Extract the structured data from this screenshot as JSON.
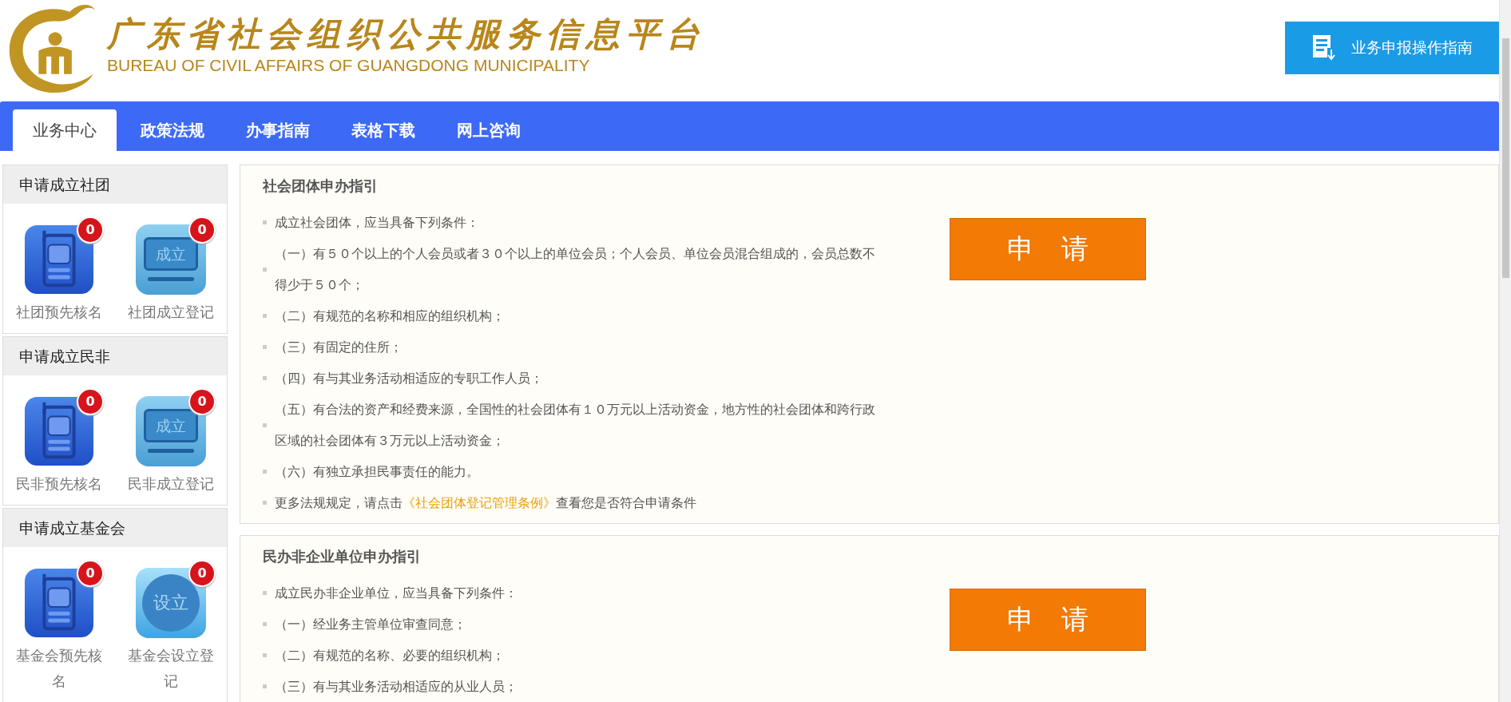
{
  "header": {
    "title": "广东省社会组织公共服务信息平台",
    "subtitle": "BUREAU OF CIVIL AFFAIRS OF GUANGDONG MUNICIPALITY",
    "guide_button": "业务申报操作指南"
  },
  "nav": [
    {
      "label": "业务中心",
      "selected": true
    },
    {
      "label": "政策法规",
      "selected": false
    },
    {
      "label": "办事指南",
      "selected": false
    },
    {
      "label": "表格下载",
      "selected": false
    },
    {
      "label": "网上咨询",
      "selected": false
    }
  ],
  "sidebar": [
    {
      "title": "申请成立社团",
      "items": [
        {
          "kind": "phone",
          "label": "社团预先核名",
          "badge": "0"
        },
        {
          "kind": "monitor",
          "icon_text": "成立",
          "label": "社团成立登记",
          "badge": "0"
        }
      ]
    },
    {
      "title": "申请成立民非",
      "items": [
        {
          "kind": "phone",
          "label": "民非预先核名",
          "badge": "0"
        },
        {
          "kind": "monitor",
          "icon_text": "成立",
          "label": "民非成立登记",
          "badge": "0"
        }
      ]
    },
    {
      "title": "申请成立基金会",
      "items": [
        {
          "kind": "phone",
          "label": "基金会预先核名",
          "badge": "0"
        },
        {
          "kind": "circle",
          "icon_text": "设立",
          "label": "基金会设立登记",
          "badge": "0"
        }
      ]
    }
  ],
  "sections": [
    {
      "title": "社会团体申办指引",
      "button": "申　请",
      "items": [
        {
          "kind": "text",
          "text": "成立社会团体，应当具备下列条件："
        },
        {
          "kind": "text",
          "text": "（一）有５０个以上的个人会员或者３０个以上的单位会员；个人会员、单位会员混合组成的，会员总数不得少于５０个；"
        },
        {
          "kind": "text",
          "text": "（二）有规范的名称和相应的组织机构；"
        },
        {
          "kind": "text",
          "text": "（三）有固定的住所；"
        },
        {
          "kind": "text",
          "text": "（四）有与其业务活动相适应的专职工作人员；"
        },
        {
          "kind": "text",
          "text": "（五）有合法的资产和经费来源，全国性的社会团体有１０万元以上活动资金，地方性的社会团体和跨行政区域的社会团体有３万元以上活动资金；"
        },
        {
          "kind": "text",
          "text": "（六）有独立承担民事责任的能力。"
        },
        {
          "kind": "link",
          "before": "更多法规规定，请点击",
          "link": "《社会团体登记管理条例》",
          "after": "查看您是否符合申请条件"
        }
      ]
    },
    {
      "title": "民办非企业单位申办指引",
      "button": "申　请",
      "items": [
        {
          "kind": "text",
          "text": "成立民办非企业单位，应当具备下列条件："
        },
        {
          "kind": "text",
          "text": "（一）经业务主管单位审查同意；"
        },
        {
          "kind": "text",
          "text": "（二）有规范的名称、必要的组织机构；"
        },
        {
          "kind": "text",
          "text": "（三）有与其业务活动相适应的从业人员；"
        }
      ]
    }
  ]
}
